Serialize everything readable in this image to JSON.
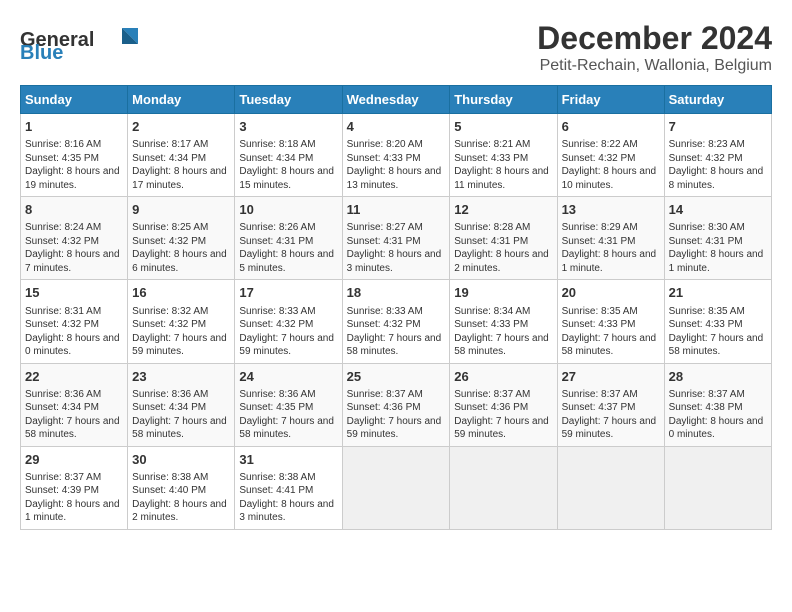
{
  "header": {
    "logo_general": "General",
    "logo_blue": "Blue",
    "month": "December 2024",
    "location": "Petit-Rechain, Wallonia, Belgium"
  },
  "days_of_week": [
    "Sunday",
    "Monday",
    "Tuesday",
    "Wednesday",
    "Thursday",
    "Friday",
    "Saturday"
  ],
  "weeks": [
    [
      {
        "day": "1",
        "sunrise": "8:16 AM",
        "sunset": "4:35 PM",
        "daylight": "8 hours and 19 minutes."
      },
      {
        "day": "2",
        "sunrise": "8:17 AM",
        "sunset": "4:34 PM",
        "daylight": "8 hours and 17 minutes."
      },
      {
        "day": "3",
        "sunrise": "8:18 AM",
        "sunset": "4:34 PM",
        "daylight": "8 hours and 15 minutes."
      },
      {
        "day": "4",
        "sunrise": "8:20 AM",
        "sunset": "4:33 PM",
        "daylight": "8 hours and 13 minutes."
      },
      {
        "day": "5",
        "sunrise": "8:21 AM",
        "sunset": "4:33 PM",
        "daylight": "8 hours and 11 minutes."
      },
      {
        "day": "6",
        "sunrise": "8:22 AM",
        "sunset": "4:32 PM",
        "daylight": "8 hours and 10 minutes."
      },
      {
        "day": "7",
        "sunrise": "8:23 AM",
        "sunset": "4:32 PM",
        "daylight": "8 hours and 8 minutes."
      }
    ],
    [
      {
        "day": "8",
        "sunrise": "8:24 AM",
        "sunset": "4:32 PM",
        "daylight": "8 hours and 7 minutes."
      },
      {
        "day": "9",
        "sunrise": "8:25 AM",
        "sunset": "4:32 PM",
        "daylight": "8 hours and 6 minutes."
      },
      {
        "day": "10",
        "sunrise": "8:26 AM",
        "sunset": "4:31 PM",
        "daylight": "8 hours and 5 minutes."
      },
      {
        "day": "11",
        "sunrise": "8:27 AM",
        "sunset": "4:31 PM",
        "daylight": "8 hours and 3 minutes."
      },
      {
        "day": "12",
        "sunrise": "8:28 AM",
        "sunset": "4:31 PM",
        "daylight": "8 hours and 2 minutes."
      },
      {
        "day": "13",
        "sunrise": "8:29 AM",
        "sunset": "4:31 PM",
        "daylight": "8 hours and 1 minute."
      },
      {
        "day": "14",
        "sunrise": "8:30 AM",
        "sunset": "4:31 PM",
        "daylight": "8 hours and 1 minute."
      }
    ],
    [
      {
        "day": "15",
        "sunrise": "8:31 AM",
        "sunset": "4:32 PM",
        "daylight": "8 hours and 0 minutes."
      },
      {
        "day": "16",
        "sunrise": "8:32 AM",
        "sunset": "4:32 PM",
        "daylight": "7 hours and 59 minutes."
      },
      {
        "day": "17",
        "sunrise": "8:33 AM",
        "sunset": "4:32 PM",
        "daylight": "7 hours and 59 minutes."
      },
      {
        "day": "18",
        "sunrise": "8:33 AM",
        "sunset": "4:32 PM",
        "daylight": "7 hours and 58 minutes."
      },
      {
        "day": "19",
        "sunrise": "8:34 AM",
        "sunset": "4:33 PM",
        "daylight": "7 hours and 58 minutes."
      },
      {
        "day": "20",
        "sunrise": "8:35 AM",
        "sunset": "4:33 PM",
        "daylight": "7 hours and 58 minutes."
      },
      {
        "day": "21",
        "sunrise": "8:35 AM",
        "sunset": "4:33 PM",
        "daylight": "7 hours and 58 minutes."
      }
    ],
    [
      {
        "day": "22",
        "sunrise": "8:36 AM",
        "sunset": "4:34 PM",
        "daylight": "7 hours and 58 minutes."
      },
      {
        "day": "23",
        "sunrise": "8:36 AM",
        "sunset": "4:34 PM",
        "daylight": "7 hours and 58 minutes."
      },
      {
        "day": "24",
        "sunrise": "8:36 AM",
        "sunset": "4:35 PM",
        "daylight": "7 hours and 58 minutes."
      },
      {
        "day": "25",
        "sunrise": "8:37 AM",
        "sunset": "4:36 PM",
        "daylight": "7 hours and 59 minutes."
      },
      {
        "day": "26",
        "sunrise": "8:37 AM",
        "sunset": "4:36 PM",
        "daylight": "7 hours and 59 minutes."
      },
      {
        "day": "27",
        "sunrise": "8:37 AM",
        "sunset": "4:37 PM",
        "daylight": "7 hours and 59 minutes."
      },
      {
        "day": "28",
        "sunrise": "8:37 AM",
        "sunset": "4:38 PM",
        "daylight": "8 hours and 0 minutes."
      }
    ],
    [
      {
        "day": "29",
        "sunrise": "8:37 AM",
        "sunset": "4:39 PM",
        "daylight": "8 hours and 1 minute."
      },
      {
        "day": "30",
        "sunrise": "8:38 AM",
        "sunset": "4:40 PM",
        "daylight": "8 hours and 2 minutes."
      },
      {
        "day": "31",
        "sunrise": "8:38 AM",
        "sunset": "4:41 PM",
        "daylight": "8 hours and 3 minutes."
      },
      null,
      null,
      null,
      null
    ]
  ]
}
